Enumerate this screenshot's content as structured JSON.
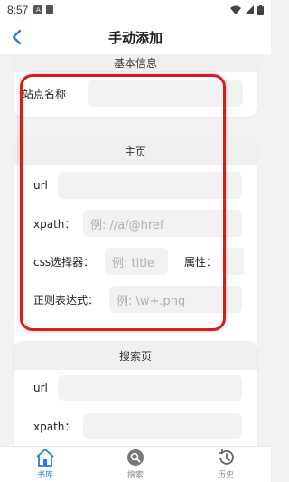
{
  "status_bar": {
    "time": "8:57"
  },
  "app_bar": {
    "title": "手动添加"
  },
  "basic_info": {
    "header": "基本信息",
    "site_name_label": "站点名称"
  },
  "home_page": {
    "header": "主页",
    "url_label": "url",
    "xpath_label": "xpath：",
    "xpath_placeholder": "例: //a/@href",
    "css_label": "css选择器：",
    "css_placeholder": "例: title",
    "attr_label": "属性：",
    "regex_label": "正则表达式：",
    "regex_placeholder": "例: \\w+.png"
  },
  "search_page": {
    "header": "搜索页",
    "url_label": "url",
    "xpath_label": "xpath："
  },
  "bottom_nav": {
    "items": [
      {
        "label": "书库",
        "icon": "home-icon"
      },
      {
        "label": "搜索",
        "icon": "search-icon"
      },
      {
        "label": "历史",
        "icon": "history-icon"
      }
    ]
  },
  "colors": {
    "accent": "#2a7be4",
    "highlight": "#d81c1c"
  }
}
